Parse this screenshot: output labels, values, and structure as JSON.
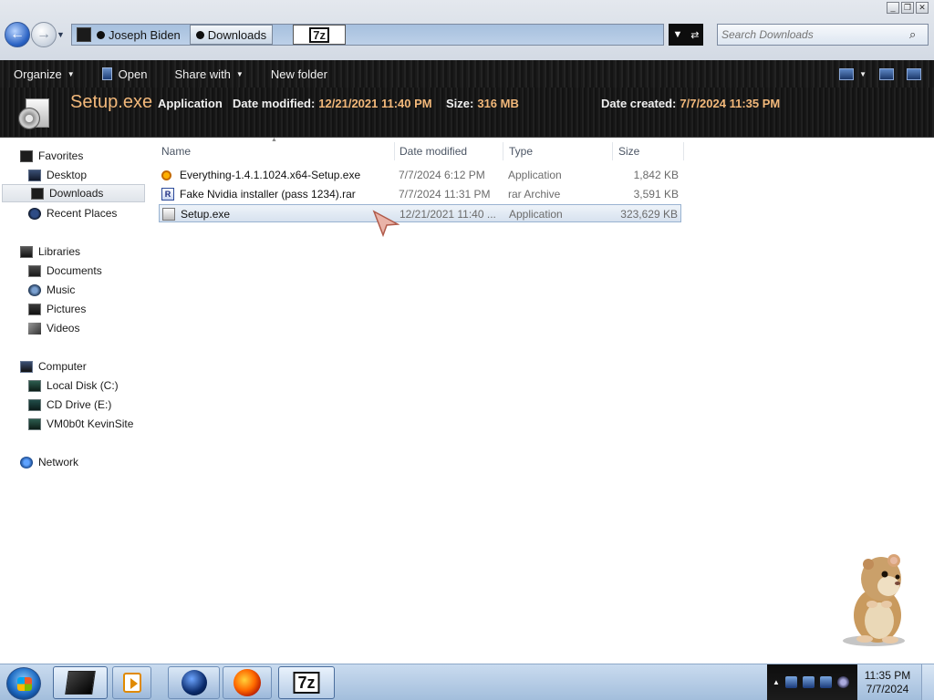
{
  "address": {
    "crumbs": [
      "Joseph Biden",
      "Downloads"
    ],
    "tab_label": "7z"
  },
  "search": {
    "placeholder": "Search Downloads"
  },
  "toolbar": {
    "organize": "Organize",
    "open": "Open",
    "share_with": "Share with",
    "new_folder": "New folder"
  },
  "details": {
    "name": "Setup.exe",
    "type": "Application",
    "modified_label": "Date modified:",
    "modified": "12/21/2021 11:40 PM",
    "size_label": "Size:",
    "size": "316 MB",
    "created_label": "Date created:",
    "created": "7/7/2024 11:35 PM"
  },
  "nav": {
    "favorites": "Favorites",
    "desktop": "Desktop",
    "downloads": "Downloads",
    "recent_places": "Recent Places",
    "libraries": "Libraries",
    "documents": "Documents",
    "music": "Music",
    "pictures": "Pictures",
    "videos": "Videos",
    "computer": "Computer",
    "local_disk": "Local Disk (C:)",
    "cd_drive": "CD Drive (E:)",
    "network_drive": "VM0b0t KevinSite",
    "network": "Network"
  },
  "columns": {
    "name": "Name",
    "date_modified": "Date modified",
    "type": "Type",
    "size": "Size"
  },
  "files": [
    {
      "name": "Everything-1.4.1.1024.x64-Setup.exe",
      "date": "7/7/2024 6:12 PM",
      "type": "Application",
      "size": "1,842 KB"
    },
    {
      "name": "Fake Nvidia installer (pass 1234).rar",
      "date": "7/7/2024 11:31 PM",
      "type": "rar Archive",
      "size": "3,591 KB"
    },
    {
      "name": "Setup.exe",
      "date": "12/21/2021 11:40 ...",
      "type": "Application",
      "size": "323,629 KB"
    }
  ],
  "taskbar": {
    "pinned_7z": "7z",
    "time": "11:35 PM",
    "date": "7/7/2024"
  },
  "colors": {
    "details_accent": "#f2b87a",
    "selection": "#d7e2ef"
  }
}
